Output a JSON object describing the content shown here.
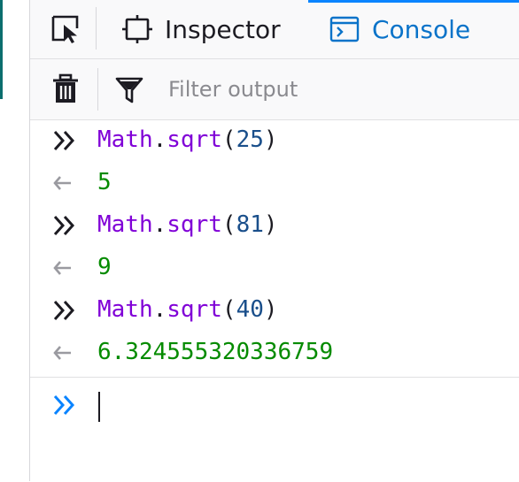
{
  "tabs": {
    "inspector": "Inspector",
    "console": "Console"
  },
  "filter": {
    "placeholder": "Filter output"
  },
  "entries": [
    {
      "kind": "input",
      "obj": "Math",
      "dot": ".",
      "method": "sqrt",
      "open": "(",
      "arg": "25",
      "close": ")"
    },
    {
      "kind": "result",
      "value": "5"
    },
    {
      "kind": "input",
      "obj": "Math",
      "dot": ".",
      "method": "sqrt",
      "open": "(",
      "arg": "81",
      "close": ")"
    },
    {
      "kind": "result",
      "value": "9"
    },
    {
      "kind": "input",
      "obj": "Math",
      "dot": ".",
      "method": "sqrt",
      "open": "(",
      "arg": "40",
      "close": ")"
    },
    {
      "kind": "result",
      "value": "6.324555320336759"
    }
  ],
  "prompt": {
    "value": ""
  },
  "colors": {
    "accent": "#0a84ff",
    "object_token": "#8000d7",
    "number_token": "#1a4f8b",
    "result_token": "#058b00",
    "prompt_chevron": "#0a84ff"
  },
  "icons": {
    "picker": "element-picker-icon",
    "inspector": "inspector-icon",
    "console": "console-icon",
    "trash": "trash-icon",
    "filter": "filter-icon",
    "input_marker": "chevron-double-right-icon",
    "result_marker": "arrow-left-icon"
  }
}
